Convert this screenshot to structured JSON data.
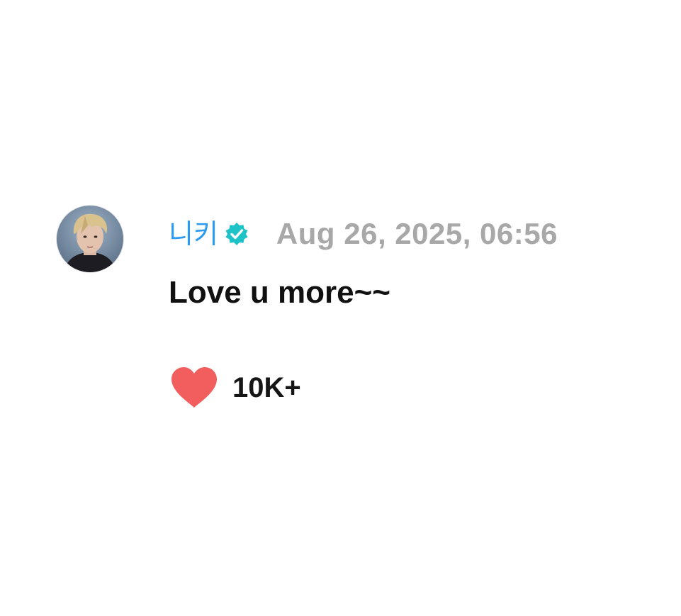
{
  "colors": {
    "accent": "#2d9bf0",
    "verified_badge": "#1ec3c7",
    "heart": "#f25d5d",
    "timestamp": "#a8a8a8"
  },
  "comment": {
    "author": "니키",
    "verified_icon": "verified-badge-icon",
    "timestamp": "Aug 26, 2025, 06:56",
    "text": "Love u more~~",
    "like_icon": "heart-icon",
    "like_count": "10K+"
  }
}
